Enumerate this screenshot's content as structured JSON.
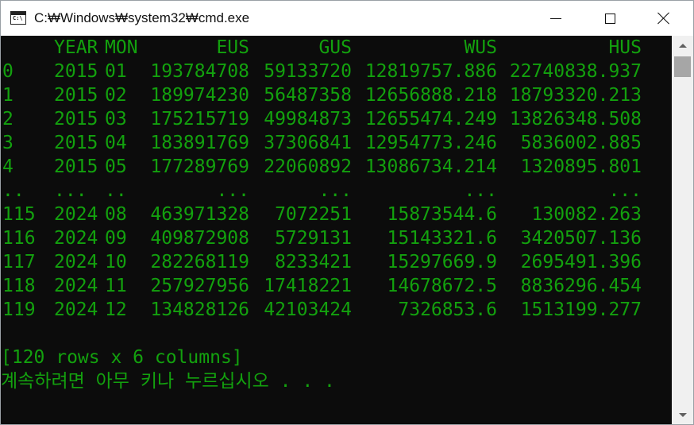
{
  "window": {
    "title": "C:₩Windows₩system32₩cmd.exe",
    "icon": "cmd-console-icon",
    "icon_text": "C:\\",
    "buttons": [
      "minimize-icon",
      "maximize-icon",
      "close-icon"
    ]
  },
  "colors": {
    "console_background": "#0c0c0c",
    "console_text": "#13a10e",
    "titlebar": "#ffffff",
    "scrollbar_track": "#f0f0f0",
    "scrollbar_thumb": "#a6a6a6"
  },
  "table": {
    "header": {
      "index": "",
      "year": "YEAR",
      "mon": "MON",
      "eus": "EUS",
      "gus": "GUS",
      "wus": "WUS",
      "hus": "HUS"
    },
    "rows": [
      {
        "index": "0",
        "year": "2015",
        "mon": "01",
        "eus": "193784708",
        "gus": "59133720",
        "wus": "12819757.886",
        "hus": "22740838.937"
      },
      {
        "index": "1",
        "year": "2015",
        "mon": "02",
        "eus": "189974230",
        "gus": "56487358",
        "wus": "12656888.218",
        "hus": "18793320.213"
      },
      {
        "index": "2",
        "year": "2015",
        "mon": "03",
        "eus": "175215719",
        "gus": "49984873",
        "wus": "12655474.249",
        "hus": "13826348.508"
      },
      {
        "index": "3",
        "year": "2015",
        "mon": "04",
        "eus": "183891769",
        "gus": "37306841",
        "wus": "12954773.246",
        "hus": "5836002.885"
      },
      {
        "index": "4",
        "year": "2015",
        "mon": "05",
        "eus": "177289769",
        "gus": "22060892",
        "wus": "13086734.214",
        "hus": "1320895.801"
      },
      {
        "index": "..",
        "year": "...",
        "mon": "..",
        "eus": "...",
        "gus": "...",
        "wus": "...",
        "hus": "..."
      },
      {
        "index": "115",
        "year": "2024",
        "mon": "08",
        "eus": "463971328",
        "gus": "7072251",
        "wus": "15873544.6",
        "hus": "130082.263"
      },
      {
        "index": "116",
        "year": "2024",
        "mon": "09",
        "eus": "409872908",
        "gus": "5729131",
        "wus": "15143321.6",
        "hus": "3420507.136"
      },
      {
        "index": "117",
        "year": "2024",
        "mon": "10",
        "eus": "282268119",
        "gus": "8233421",
        "wus": "15297669.9",
        "hus": "2695491.396"
      },
      {
        "index": "118",
        "year": "2024",
        "mon": "11",
        "eus": "257927956",
        "gus": "17418221",
        "wus": "14678672.5",
        "hus": "8836296.454"
      },
      {
        "index": "119",
        "year": "2024",
        "mon": "12",
        "eus": "134828126",
        "gus": "42103424",
        "wus": "7326853.6",
        "hus": "1513199.277"
      }
    ]
  },
  "summary": "[120 rows x 6 columns]",
  "prompt": "계속하려면 아무 키나 누르십시오 . . ."
}
